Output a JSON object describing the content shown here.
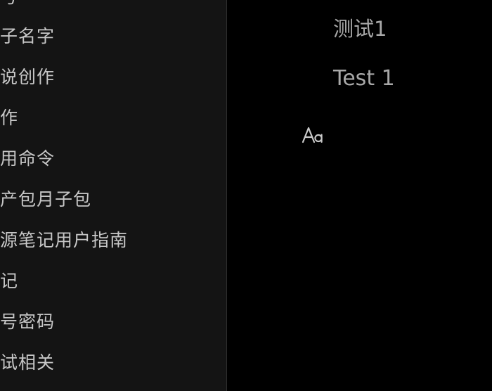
{
  "sidebar": {
    "items": [
      {
        "label": "号"
      },
      {
        "label": "子名字"
      },
      {
        "label": "说创作"
      },
      {
        "label": "作"
      },
      {
        "label": "用命令"
      },
      {
        "label": "产包月子包"
      },
      {
        "label": "源笔记用户指南"
      },
      {
        "label": "记"
      },
      {
        "label": "号密码"
      },
      {
        "label": "试相关"
      }
    ]
  },
  "editor": {
    "title": "测试1",
    "body": "Test 1",
    "format_icon": "text-format-icon"
  },
  "colors": {
    "sidebar_bg": "#141414",
    "editor_bg": "#000000",
    "sidebar_text": "#c7c7c7",
    "editor_text": "#a8a8a8"
  }
}
